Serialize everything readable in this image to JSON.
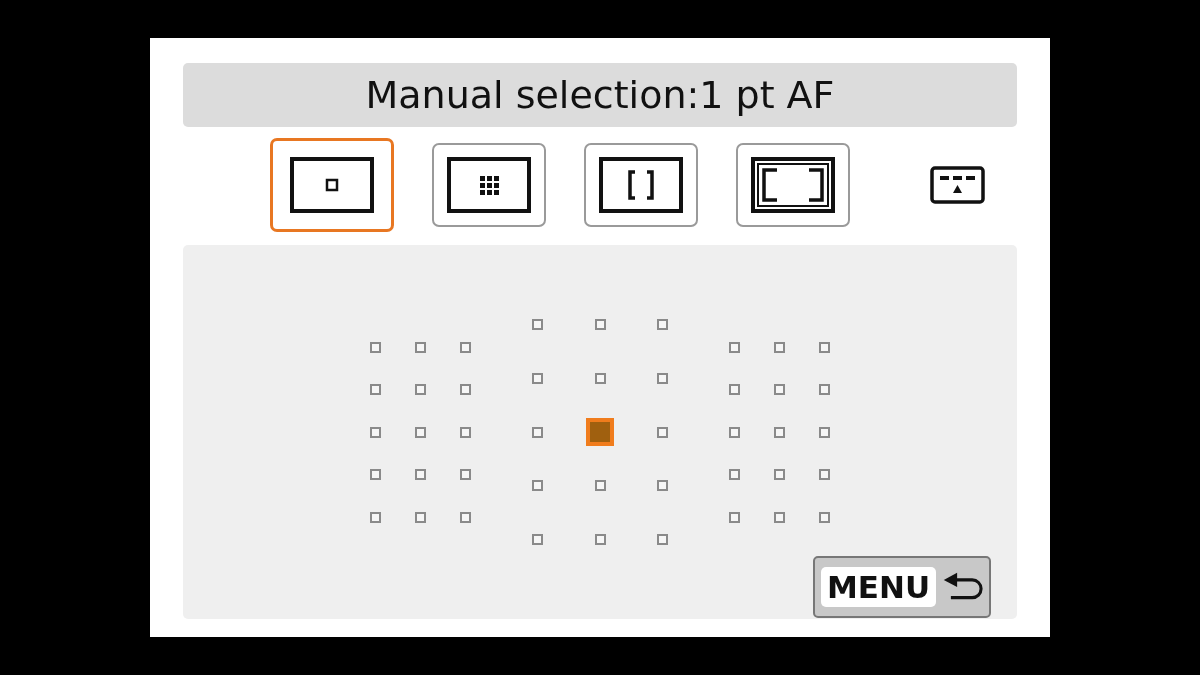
{
  "title": "Manual selection:1 pt AF",
  "modes": [
    {
      "kind": "single",
      "selected": true
    },
    {
      "kind": "zone",
      "selected": false
    },
    {
      "kind": "large-zone-vertical",
      "selected": false
    },
    {
      "kind": "large-zone-horizontal",
      "selected": false
    }
  ],
  "af_groups": [
    {
      "kind": "side",
      "points": [
        {
          "selected": false
        },
        {
          "selected": false
        },
        {
          "selected": false
        },
        {
          "selected": false
        },
        {
          "selected": false
        },
        {
          "selected": false
        },
        {
          "selected": false
        },
        {
          "selected": false
        },
        {
          "selected": false
        },
        {
          "selected": false
        },
        {
          "selected": false
        },
        {
          "selected": false
        },
        {
          "selected": false
        },
        {
          "selected": false
        },
        {
          "selected": false
        }
      ]
    },
    {
      "kind": "center",
      "points": [
        {
          "selected": false
        },
        {
          "selected": false
        },
        {
          "selected": false
        },
        {
          "selected": false
        },
        {
          "selected": false
        },
        {
          "selected": false
        },
        {
          "selected": false
        },
        {
          "selected": true
        },
        {
          "selected": false
        },
        {
          "selected": false
        },
        {
          "selected": false
        },
        {
          "selected": false
        },
        {
          "selected": false
        },
        {
          "selected": false
        },
        {
          "selected": false
        }
      ]
    },
    {
      "kind": "side",
      "points": [
        {
          "selected": false
        },
        {
          "selected": false
        },
        {
          "selected": false
        },
        {
          "selected": false
        },
        {
          "selected": false
        },
        {
          "selected": false
        },
        {
          "selected": false
        },
        {
          "selected": false
        },
        {
          "selected": false
        },
        {
          "selected": false
        },
        {
          "selected": false
        },
        {
          "selected": false
        },
        {
          "selected": false
        },
        {
          "selected": false
        },
        {
          "selected": false
        }
      ]
    }
  ],
  "menu_button": {
    "label": "MENU"
  }
}
